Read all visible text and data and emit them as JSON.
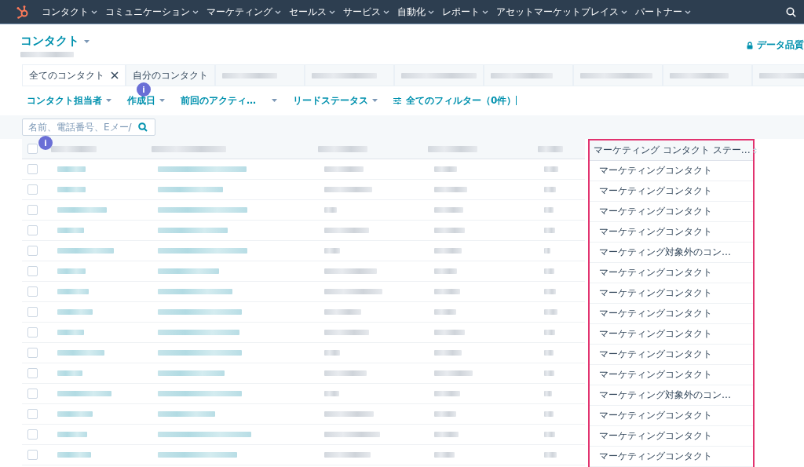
{
  "nav": {
    "items": [
      "コンタクト",
      "コミュニケーション",
      "マーケティング",
      "セールス",
      "サービス",
      "自動化",
      "レポート",
      "アセットマーケットプレイス",
      "パートナー"
    ]
  },
  "header": {
    "title": "コンタクト",
    "data_quality": "データ品質"
  },
  "tabs": [
    {
      "label": "全てのコンタクト",
      "selected": true,
      "closable": true
    },
    {
      "label": "自分のコンタクト",
      "selected": false,
      "closable": false
    }
  ],
  "filters": [
    {
      "label": "コンタクト担当者",
      "kind": "dropdown"
    },
    {
      "label": "作成日",
      "kind": "dropdown"
    },
    {
      "label": "前回のアクティ…",
      "kind": "dropdown"
    },
    {
      "label": "リードステータス",
      "kind": "dropdown"
    },
    {
      "label": "全てのフィルター（0件）",
      "kind": "all"
    }
  ],
  "search": {
    "placeholder": "名前、電話番号、Eメー/"
  },
  "markers": [
    {
      "text": "i"
    },
    {
      "text": "i"
    }
  ],
  "table": {
    "header_checked": false,
    "status_column": {
      "title": "マーケティング コンタクト ステー…",
      "highlighted": true
    },
    "rows": [
      {
        "checked": false,
        "status": "マーケティングコンタクト"
      },
      {
        "checked": false,
        "status": "マーケティングコンタクト"
      },
      {
        "checked": false,
        "status": "マーケティングコンタクト"
      },
      {
        "checked": false,
        "status": "マーケティングコンタクト"
      },
      {
        "checked": false,
        "status": "マーケティング対象外のコン…"
      },
      {
        "checked": false,
        "status": "マーケティングコンタクト"
      },
      {
        "checked": false,
        "status": "マーケティングコンタクト"
      },
      {
        "checked": false,
        "status": "マーケティングコンタクト"
      },
      {
        "checked": false,
        "status": "マーケティングコンタクト"
      },
      {
        "checked": false,
        "status": "マーケティングコンタクト"
      },
      {
        "checked": false,
        "status": "マーケティングコンタクト"
      },
      {
        "checked": false,
        "status": "マーケティング対象外のコン…"
      },
      {
        "checked": false,
        "status": "マーケティングコンタクト"
      },
      {
        "checked": false,
        "status": "マーケティングコンタクト"
      },
      {
        "checked": false,
        "status": "マーケティングコンタクト"
      }
    ]
  }
}
